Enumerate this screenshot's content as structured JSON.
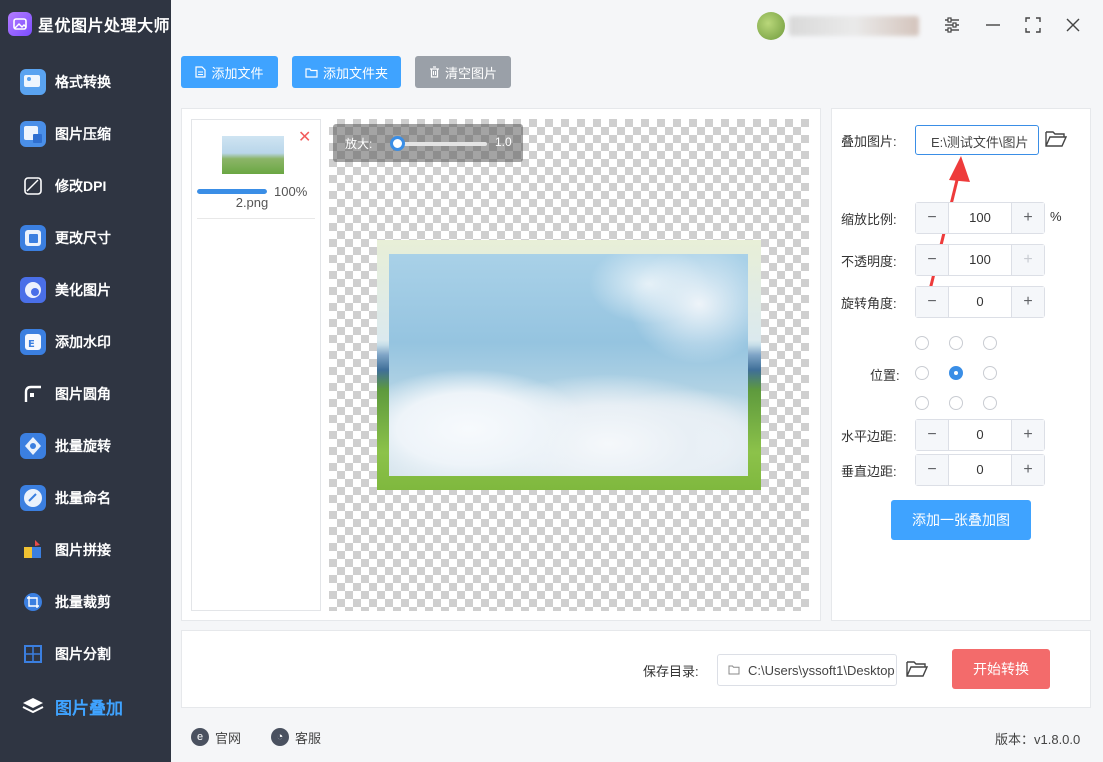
{
  "app": {
    "title": "星优图片处理大师"
  },
  "sidebar": {
    "items": [
      {
        "label": "格式转换",
        "icon": "format-convert-icon",
        "color": "#5aa3f0"
      },
      {
        "label": "图片压缩",
        "icon": "image-compress-icon",
        "color": "#4a8fe8"
      },
      {
        "label": "修改DPI",
        "icon": "dpi-icon",
        "color": "#3b7fe0"
      },
      {
        "label": "更改尺寸",
        "icon": "resize-icon",
        "color": "#3b7fe0"
      },
      {
        "label": "美化图片",
        "icon": "beautify-icon",
        "color": "#4a6fe8"
      },
      {
        "label": "添加水印",
        "icon": "watermark-icon",
        "color": "#3b7fe0"
      },
      {
        "label": "图片圆角",
        "icon": "round-corner-icon",
        "color": "#4a8fe8"
      },
      {
        "label": "批量旋转",
        "icon": "rotate-icon",
        "color": "#3b7fe0"
      },
      {
        "label": "批量命名",
        "icon": "rename-icon",
        "color": "#3b7fe0"
      },
      {
        "label": "图片拼接",
        "icon": "puzzle-icon",
        "color": "#3b7fe0"
      },
      {
        "label": "批量裁剪",
        "icon": "crop-icon",
        "color": "#3b7fe0"
      },
      {
        "label": "图片分割",
        "icon": "split-icon",
        "color": "#3b7fe0"
      },
      {
        "label": "图片叠加",
        "icon": "layers-icon",
        "color": "#ffffff",
        "active": true
      }
    ]
  },
  "toolbar": {
    "add_file": "添加文件",
    "add_folder": "添加文件夹",
    "clear_images": "清空图片"
  },
  "file_list": {
    "items": [
      {
        "name": "2.png",
        "progress_label": "100%",
        "progress": 1.0
      }
    ]
  },
  "preview": {
    "zoom_label": "放大:",
    "zoom_value": "1.0",
    "zoom_fraction": 0.0
  },
  "settings": {
    "overlay_label": "叠加图片:",
    "overlay_path": "E:\\测试文件\\图片",
    "scale_label": "缩放比例:",
    "scale_value": "100",
    "scale_unit": "%",
    "opacity_label": "不透明度:",
    "opacity_value": "100",
    "rotation_label": "旋转角度:",
    "rotation_value": "0",
    "position_label": "位置:",
    "position_selected": "middle-center",
    "h_margin_label": "水平边距:",
    "h_margin_value": "0",
    "v_margin_label": "垂直边距:",
    "v_margin_value": "0",
    "add_overlay_button": "添加一张叠加图"
  },
  "save": {
    "label": "保存目录:",
    "path": "C:\\Users\\yssoft1\\Desktop",
    "start_button": "开始转换"
  },
  "footer": {
    "website": "官网",
    "support": "客服",
    "version": "版本：v1.8.0.0"
  },
  "colors": {
    "sidebar_bg": "#2f3542",
    "accent_blue": "#3fa3ff",
    "clear_gray": "#9aa0a8",
    "start_red": "#f36b6b",
    "annotation_arrow": "#ee3b3b"
  }
}
